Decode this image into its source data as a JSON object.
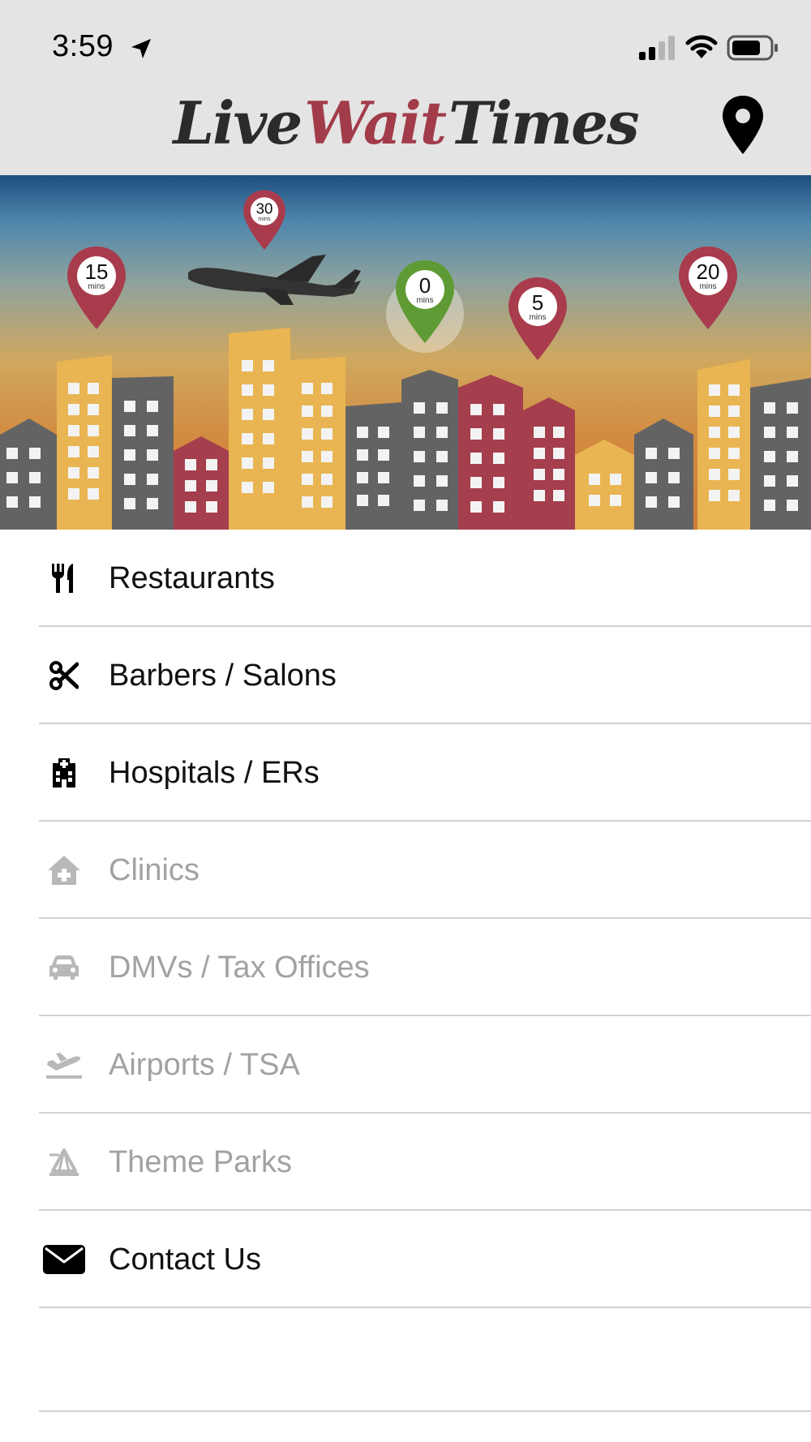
{
  "status_bar": {
    "time": "3:59",
    "icons": [
      "location-arrow-icon",
      "cellular-signal-icon",
      "wifi-icon",
      "battery-icon"
    ]
  },
  "header": {
    "logo": {
      "word1": "Live",
      "word2": "Wait",
      "word3": "Times"
    },
    "action_icon": "map-pin-icon",
    "colors": {
      "background": "#e4e4e4",
      "logo_dark": "#2b2b2b",
      "logo_accent": "#a23c4a"
    }
  },
  "hero": {
    "pins": [
      {
        "value": "15",
        "unit": "mins",
        "color": "#a83c4d"
      },
      {
        "value": "30",
        "unit": "mins",
        "color": "#a83c4d"
      },
      {
        "value": "0",
        "unit": "mins",
        "color": "#5f9b35"
      },
      {
        "value": "5",
        "unit": "mins",
        "color": "#a83c4d"
      },
      {
        "value": "20",
        "unit": "mins",
        "color": "#a83c4d"
      }
    ],
    "colors": {
      "building_gray": "#636363",
      "building_yellow": "#e9b552",
      "building_red": "#a53e4d"
    }
  },
  "menu": {
    "items": [
      {
        "label": "Restaurants",
        "icon": "fork-knife-icon",
        "enabled": true
      },
      {
        "label": "Barbers / Salons",
        "icon": "scissors-icon",
        "enabled": true
      },
      {
        "label": "Hospitals / ERs",
        "icon": "hospital-icon",
        "enabled": true
      },
      {
        "label": "Clinics",
        "icon": "clinic-icon",
        "enabled": false
      },
      {
        "label": "DMVs / Tax Offices",
        "icon": "car-icon",
        "enabled": false
      },
      {
        "label": "Airports / TSA",
        "icon": "airplane-takeoff-icon",
        "enabled": false
      },
      {
        "label": "Theme Parks",
        "icon": "theme-park-icon",
        "enabled": false
      },
      {
        "label": "Contact Us",
        "icon": "envelope-icon",
        "enabled": true
      }
    ],
    "colors": {
      "enabled_text": "#111111",
      "disabled_text": "#a2a2a2"
    }
  }
}
